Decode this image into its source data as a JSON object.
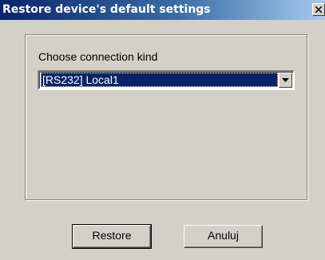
{
  "window": {
    "title": "Restore device's default settings",
    "close_glyph": "×"
  },
  "form": {
    "connection_label": "Choose connection kind",
    "connection_value": "[RS232] Local1",
    "connection_icon": "chevron-down-icon"
  },
  "buttons": {
    "restore_label": "Restore",
    "cancel_label": "Anuluj"
  },
  "colors": {
    "titlebar_start": "#0a246a",
    "titlebar_end": "#a6caf0",
    "dialog_bg": "#d4d0c8",
    "selection_bg": "#0a246a"
  }
}
